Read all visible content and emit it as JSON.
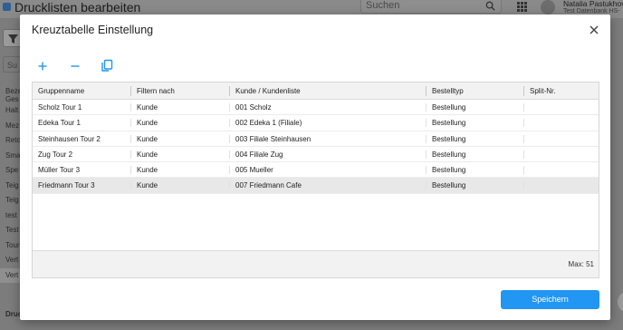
{
  "app": {
    "title": "Drucklisten bearbeiten",
    "search_placeholder": "Suchen",
    "user_name": "Natalia Pastukhov",
    "user_db": "Test Datenbank HS-",
    "sidebar_search_placeholder": "Su",
    "sidebar_items": [
      "Bezeich Ges",
      "Halt",
      "Mez",
      "Retc",
      "Sma",
      "Spe",
      "Teig",
      "Teig",
      "test",
      "Test",
      "Tour",
      "Vert",
      "Vert"
    ],
    "sidebar_footer": "Druc"
  },
  "modal": {
    "title": "Kreuztabelle Einstellung",
    "toolbar": {
      "add_icon": "plus-icon",
      "remove_icon": "minus-icon",
      "copy_icon": "copy-icon"
    },
    "columns": [
      "Gruppenname",
      "Filtern nach",
      "Kunde / Kundenliste",
      "Bestelltyp",
      "Split-Nr."
    ],
    "rows": [
      {
        "gruppenname": "Scholz Tour 1",
        "filtern_nach": "Kunde",
        "kunde": "001 Scholz",
        "bestelltyp": "Bestellung",
        "split": ""
      },
      {
        "gruppenname": "Edeka Tour 1",
        "filtern_nach": "Kunde",
        "kunde": "002 Edeka 1 (Filiale)",
        "bestelltyp": "Bestellung",
        "split": ""
      },
      {
        "gruppenname": "Steinhausen Tour 2",
        "filtern_nach": "Kunde",
        "kunde": "003 Filiale Steinhausen",
        "bestelltyp": "Bestellung",
        "split": ""
      },
      {
        "gruppenname": "Zug Tour 2",
        "filtern_nach": "Kunde",
        "kunde": "004 Filiale Zug",
        "bestelltyp": "Bestellung",
        "split": ""
      },
      {
        "gruppenname": "Müller Tour 3",
        "filtern_nach": "Kunde",
        "kunde": "005 Mueller",
        "bestelltyp": "Bestellung",
        "split": ""
      },
      {
        "gruppenname": "Friedmann Tour 3",
        "filtern_nach": "Kunde",
        "kunde": "007 Friedmann Cafe",
        "bestelltyp": "Bestellung",
        "split": ""
      }
    ],
    "selected_row_index": 5,
    "max_label": "Max: 51",
    "save_label": "Speichern"
  },
  "colors": {
    "accent": "#2196f3",
    "overlay": "#7c7c7c",
    "header_bg": "#f2f2f2",
    "selected_row": "#e8e8e8"
  }
}
